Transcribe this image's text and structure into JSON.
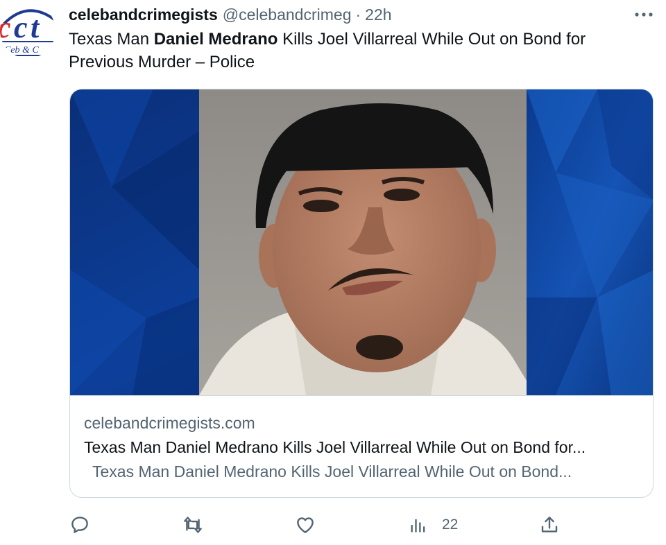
{
  "tweet": {
    "display_name": "celebandcrimegists",
    "handle": "@celebandcrimeg",
    "separator": "·",
    "time": "22h",
    "text_before": "Texas Man ",
    "text_bold": "Daniel Medrano",
    "text_after": " Kills Joel Villarreal While Out on Bond for Previous Murder – Police",
    "avatar_logo_text": "Ceb & C"
  },
  "card": {
    "domain": "celebandcrimegists.com",
    "title": "Texas Man Daniel Medrano Kills Joel Villarreal While Out on Bond for...",
    "description": "Texas Man Daniel Medrano Kills Joel Villarreal While Out on Bond..."
  },
  "actions": {
    "views_count": "22"
  },
  "icons": {
    "more": "more-dots-icon",
    "reply": "reply-icon",
    "retweet": "retweet-icon",
    "like": "heart-icon",
    "views": "analytics-icon",
    "share": "share-icon"
  },
  "colors": {
    "text_primary": "#0f1419",
    "text_secondary": "#536471",
    "border": "#cfd9de",
    "card_background_blue": "#0b3a8c"
  }
}
